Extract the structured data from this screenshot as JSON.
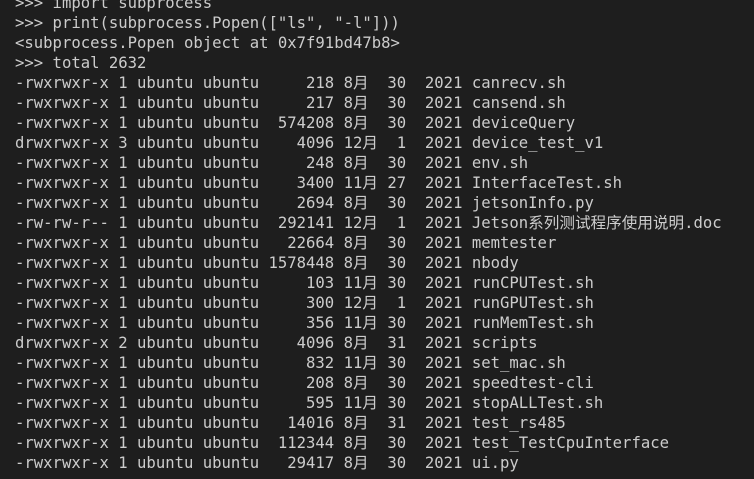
{
  "terminal": {
    "lines": [
      ">>> import subprocess",
      ">>> print(subprocess.Popen([\"ls\", \"-l\"]))",
      "<subprocess.Popen object at 0x7f91bd47b8>",
      ">>> total 2632",
      "-rwxrwxr-x 1 ubuntu ubuntu     218 8月  30  2021 canrecv.sh",
      "-rwxrwxr-x 1 ubuntu ubuntu     217 8月  30  2021 cansend.sh",
      "-rwxrwxr-x 1 ubuntu ubuntu  574208 8月  30  2021 deviceQuery",
      "drwxrwxr-x 3 ubuntu ubuntu    4096 12月  1  2021 device_test_v1",
      "-rwxrwxr-x 1 ubuntu ubuntu     248 8月  30  2021 env.sh",
      "-rwxrwxr-x 1 ubuntu ubuntu    3400 11月 27  2021 InterfaceTest.sh",
      "-rwxrwxr-x 1 ubuntu ubuntu    2694 8月  30  2021 jetsonInfo.py",
      "-rw-rw-r-- 1 ubuntu ubuntu  292141 12月  1  2021 Jetson系列测试程序使用说明.doc",
      "-rwxrwxr-x 1 ubuntu ubuntu   22664 8月  30  2021 memtester",
      "-rwxrwxr-x 1 ubuntu ubuntu 1578448 8月  30  2021 nbody",
      "-rwxrwxr-x 1 ubuntu ubuntu     103 11月 30  2021 runCPUTest.sh",
      "-rwxrwxr-x 1 ubuntu ubuntu     300 12月  1  2021 runGPUTest.sh",
      "-rwxrwxr-x 1 ubuntu ubuntu     356 11月 30  2021 runMemTest.sh",
      "drwxrwxr-x 2 ubuntu ubuntu    4096 8月  31  2021 scripts",
      "-rwxrwxr-x 1 ubuntu ubuntu     832 11月 30  2021 set_mac.sh",
      "-rwxrwxr-x 1 ubuntu ubuntu     208 8月  30  2021 speedtest-cli",
      "-rwxrwxr-x 1 ubuntu ubuntu     595 11月 30  2021 stopALLTest.sh",
      "-rwxrwxr-x 1 ubuntu ubuntu   14016 8月  31  2021 test_rs485",
      "-rwxrwxr-x 1 ubuntu ubuntu  112344 8月  30  2021 test_TestCpuInterface",
      "-rwxrwxr-x 1 ubuntu ubuntu   29417 8月  30  2021 ui.py"
    ]
  }
}
